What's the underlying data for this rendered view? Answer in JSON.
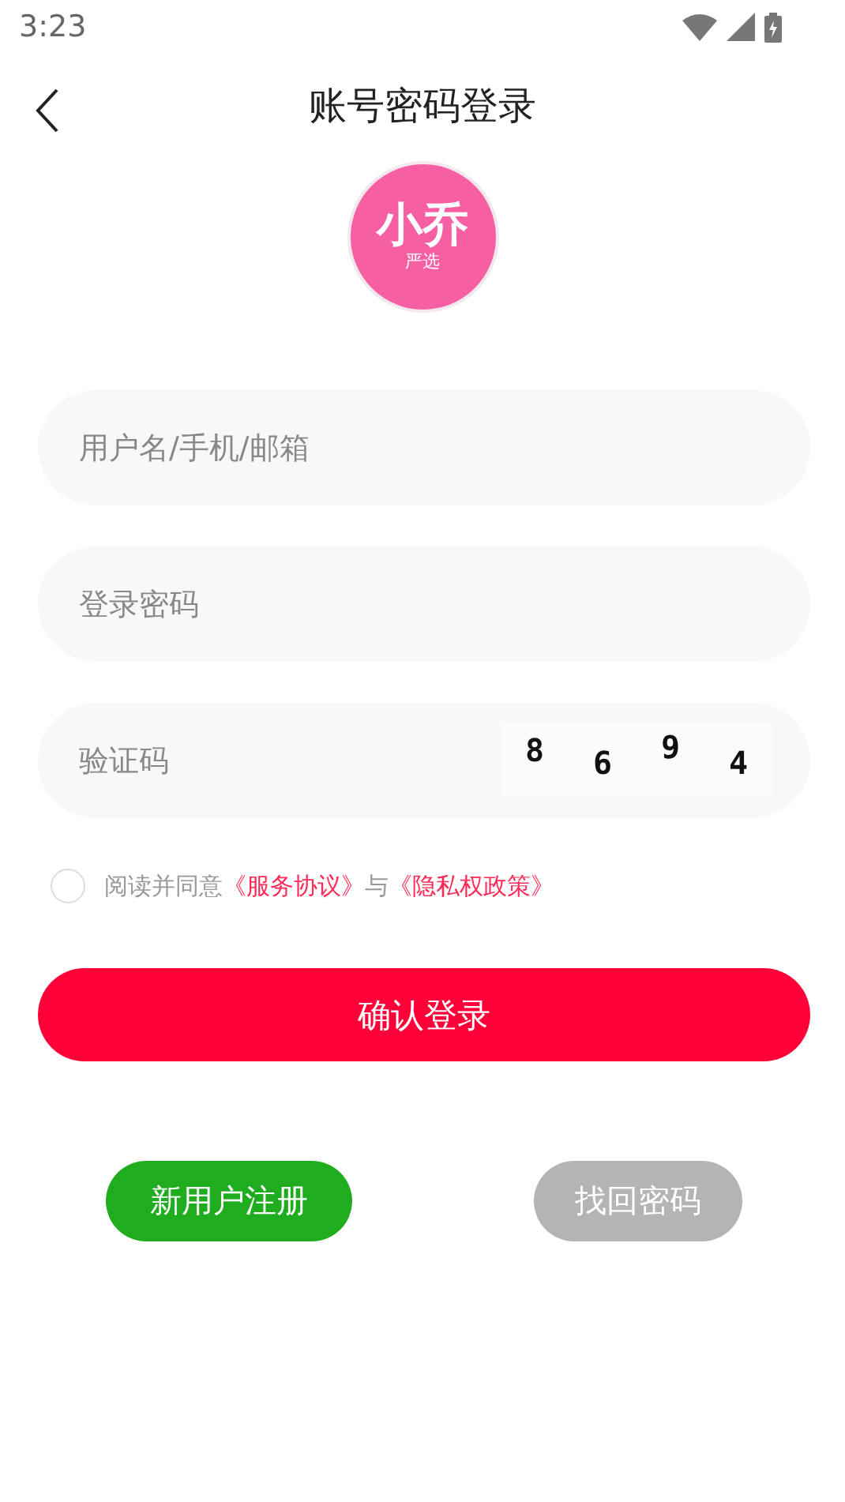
{
  "status_bar": {
    "time": "3:23"
  },
  "header": {
    "title": "账号密码登录"
  },
  "logo": {
    "name": "小乔",
    "tagline": "严选"
  },
  "fields": [
    {
      "kind": "text",
      "placeholder": "用户名/手机/邮箱"
    },
    {
      "kind": "password",
      "placeholder": "登录密码"
    },
    {
      "kind": "captcha",
      "placeholder": "验证码",
      "captcha": [
        "8",
        "6",
        "9",
        "4"
      ]
    }
  ],
  "agreement": {
    "checked": false,
    "text": "阅读并同意",
    "links": [
      "《服务协议》",
      "《隐私权政策》"
    ],
    "joiner": "与"
  },
  "login_button": "确认登录",
  "bottom_buttons": [
    {
      "label": "新用户注册",
      "disabled": false
    },
    {
      "label": "找回密码",
      "disabled": true
    }
  ]
}
